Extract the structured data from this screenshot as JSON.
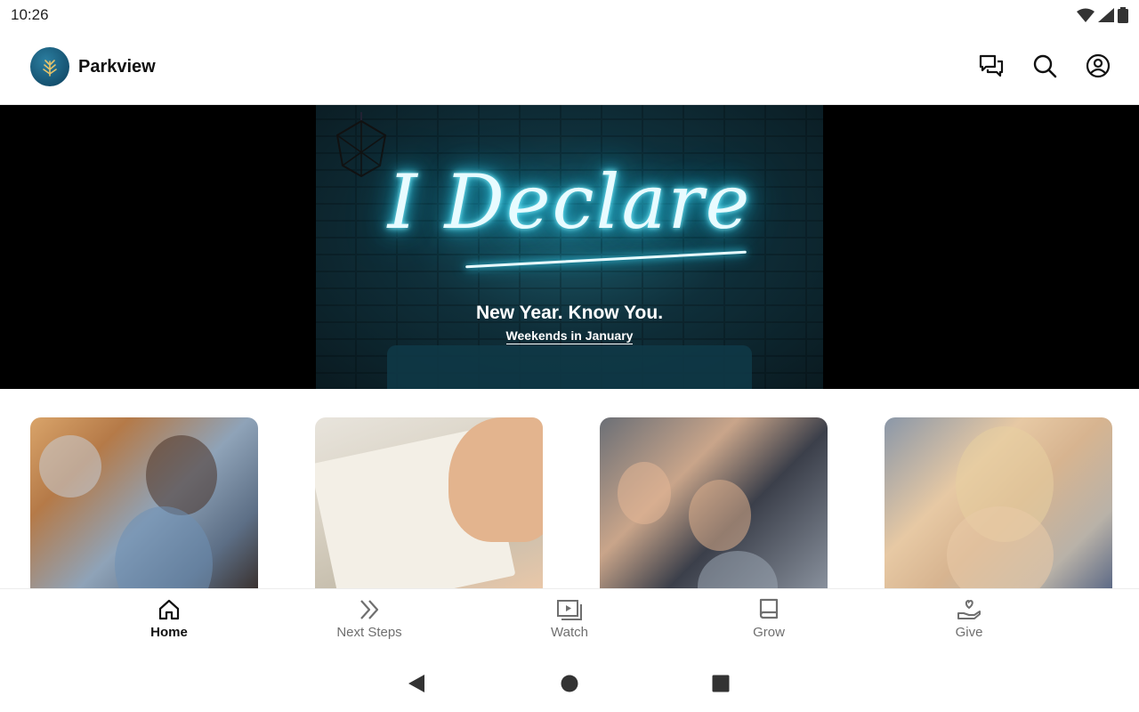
{
  "status_bar": {
    "time": "10:26",
    "icons": [
      "wifi-icon",
      "signal-icon",
      "battery-icon"
    ]
  },
  "app_bar": {
    "title": "Parkview",
    "actions": [
      "chat-icon",
      "search-icon",
      "account-icon"
    ]
  },
  "hero": {
    "neon_text": "I Declare",
    "subtitle": "New Year. Know You.",
    "caption": "Weekends in January"
  },
  "cards": [
    "people-photo",
    "journal-photo",
    "kids-photo",
    "teens-photo"
  ],
  "bottom_nav": {
    "items": [
      {
        "label": "Home",
        "icon": "home-icon",
        "active": true
      },
      {
        "label": "Next Steps",
        "icon": "double-chevron-icon",
        "active": false
      },
      {
        "label": "Watch",
        "icon": "video-icon",
        "active": false
      },
      {
        "label": "Grow",
        "icon": "book-icon",
        "active": false
      },
      {
        "label": "Give",
        "icon": "hand-heart-icon",
        "active": false
      }
    ]
  },
  "system_nav": [
    "back-button",
    "home-button",
    "recents-button"
  ],
  "colors": {
    "accent": "#111111",
    "inactive": "#6f6f6f",
    "neon": "#3fd8f5"
  }
}
